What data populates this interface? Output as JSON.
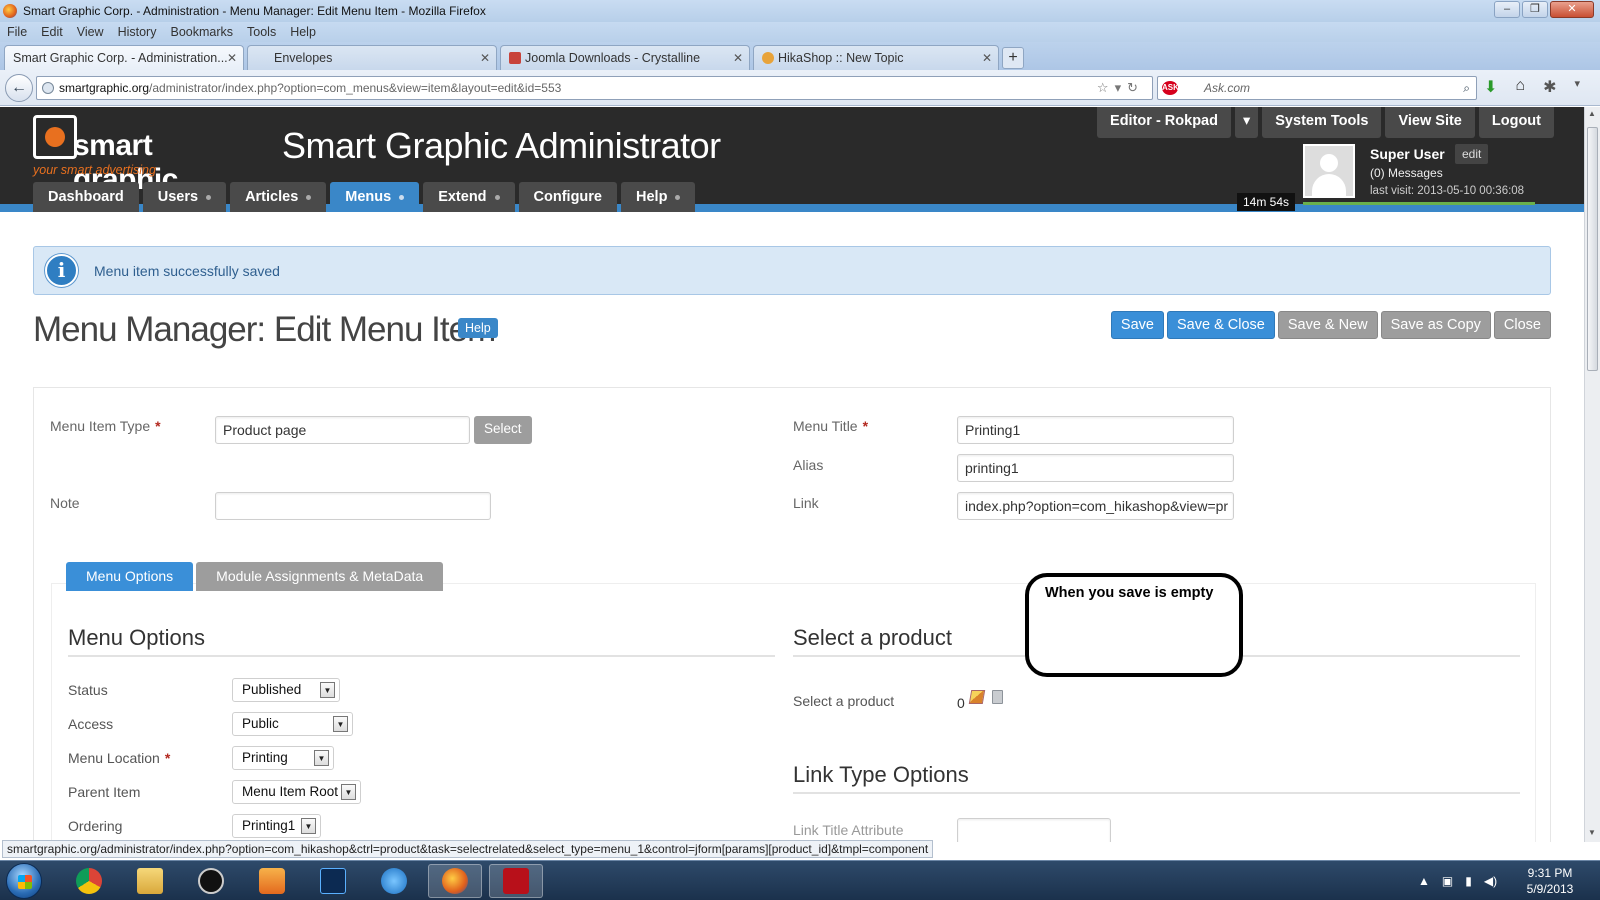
{
  "browser": {
    "window_title": "Smart Graphic Corp. - Administration - Menu Manager: Edit Menu Item - Mozilla Firefox",
    "menu": [
      "File",
      "Edit",
      "View",
      "History",
      "Bookmarks",
      "Tools",
      "Help"
    ],
    "tabs": [
      {
        "label": "Smart Graphic Corp. - Administration..."
      },
      {
        "label": "Envelopes"
      },
      {
        "label": "Joomla Downloads - Crystalline"
      },
      {
        "label": "HikaShop :: New Topic"
      }
    ],
    "url_host": "smartgraphic.org",
    "url_path": "/administrator/index.php?option=com_menus&view=item&layout=edit&id=553",
    "search_placeholder": "Ask.com",
    "status_link": "smartgraphic.org/administrator/index.php?option=com_hikashop&ctrl=product&task=selectrelated&select_type=menu_1&control=jform[params][product_id]&tmpl=component"
  },
  "header": {
    "logo_text": "smart graphic",
    "logo_tagline": "your smart advertising",
    "admin_title": "Smart Graphic Administrator",
    "top_buttons": [
      "Editor - Rokpad",
      "System Tools",
      "View Site",
      "Logout"
    ],
    "user": {
      "name": "Super User",
      "edit": "edit",
      "messages": "(0) Messages",
      "last_visit": "last visit: 2013-05-10 00:36:08"
    },
    "timer": "14m 54s",
    "nav": [
      "Dashboard",
      "Users",
      "Articles",
      "Menus",
      "Extend",
      "Configure",
      "Help"
    ]
  },
  "alert": {
    "message": "Menu item successfully saved"
  },
  "page": {
    "title": "Menu Manager: Edit Menu Item",
    "help": "Help",
    "actions": [
      "Save",
      "Save & Close",
      "Save & New",
      "Save as Copy",
      "Close"
    ]
  },
  "form": {
    "menu_item_type_label": "Menu Item Type",
    "menu_item_type_value": "Product page",
    "select_button": "Select",
    "note_label": "Note",
    "note_value": "",
    "menu_title_label": "Menu Title",
    "menu_title_value": "Printing1",
    "alias_label": "Alias",
    "alias_value": "printing1",
    "link_label": "Link",
    "link_value": "index.php?option=com_hikashop&view=pr",
    "required_mark": "*"
  },
  "tabs": [
    "Menu Options",
    "Module Assignments & MetaData"
  ],
  "menu_options": {
    "heading": "Menu Options",
    "status_label": "Status",
    "status_value": "Published",
    "access_label": "Access",
    "access_value": "Public",
    "location_label": "Menu Location",
    "location_value": "Printing",
    "parent_label": "Parent Item",
    "parent_value": "Menu Item Root",
    "ordering_label": "Ordering",
    "ordering_value": "Printing1"
  },
  "product": {
    "heading": "Select a product",
    "label": "Select a product",
    "value": "0"
  },
  "link_type": {
    "heading": "Link Type Options",
    "title_attr_label": "Link Title Attribute"
  },
  "annotation": {
    "bubble_text": "When you save is empty"
  },
  "taskbar": {
    "time": "9:31 PM",
    "date": "5/9/2013"
  }
}
